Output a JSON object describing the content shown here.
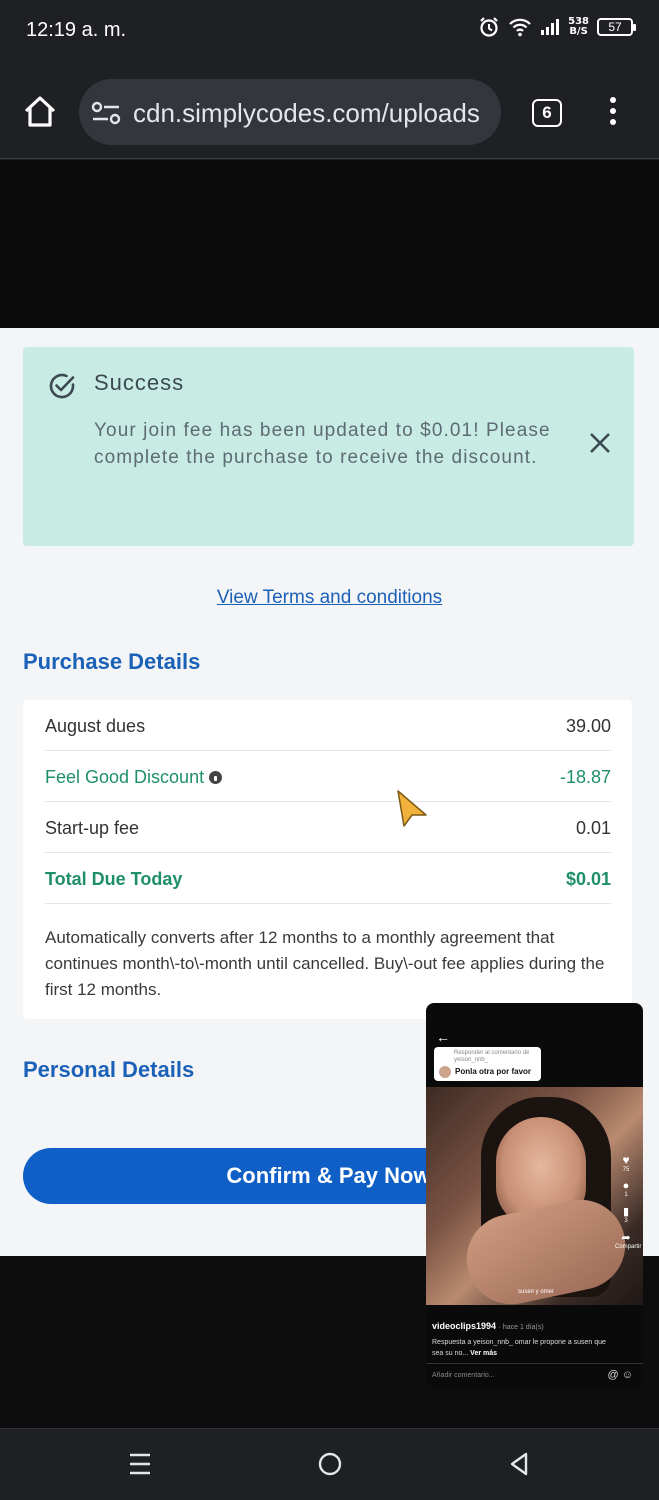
{
  "status_bar": {
    "time": "12:19 a. m.",
    "net_speed_value": "538",
    "net_speed_unit": "B/S",
    "battery": "57",
    "icons": [
      "alarm-icon",
      "wifi-icon",
      "signal-icon",
      "battery-icon"
    ]
  },
  "browser": {
    "url": "cdn.simplycodes.com/uploads",
    "tab_count": "6"
  },
  "alert": {
    "title": "Success",
    "message": "Your join fee has been updated to $0.01! Please complete the purchase to receive the discount."
  },
  "terms_link": "View Terms and conditions",
  "purchase": {
    "title": "Purchase Details",
    "rows": [
      {
        "label": "August dues",
        "value": "39.00"
      },
      {
        "label": "Feel Good Discount",
        "value": "-18.87"
      },
      {
        "label": "Start-up fee",
        "value": "0.01"
      },
      {
        "label": "Total Due Today",
        "value": "$0.01"
      }
    ],
    "note": "Automatically converts after 12 months to a monthly agreement that continues month\\-to\\-month until cancelled. Buy\\-out fee applies during the first 12 months."
  },
  "personal": {
    "title": "Personal Details"
  },
  "confirm_button": "Confirm & Pay Now",
  "pip_video": {
    "reply_top": "Responder al comentario de yeison_nnb_",
    "reply_main": "Ponla otra por favor",
    "caption": "susen y omer",
    "likes": "75",
    "comments": "1",
    "saves": "3",
    "share_label": "Compartir",
    "username": "videoclips1994",
    "time_ago": "· hace 1 día(s)",
    "description": "Respuesta a yeison_nnb_ omar le propone a susen que sea su no...",
    "see_more": "Ver más",
    "comment_placeholder": "Añadir comentario..."
  },
  "colors": {
    "accent_blue": "#1b61b8",
    "discount_green": "#1f8f6a",
    "alert_bg": "#c8ebe3",
    "button_blue": "#0f5fc6"
  }
}
